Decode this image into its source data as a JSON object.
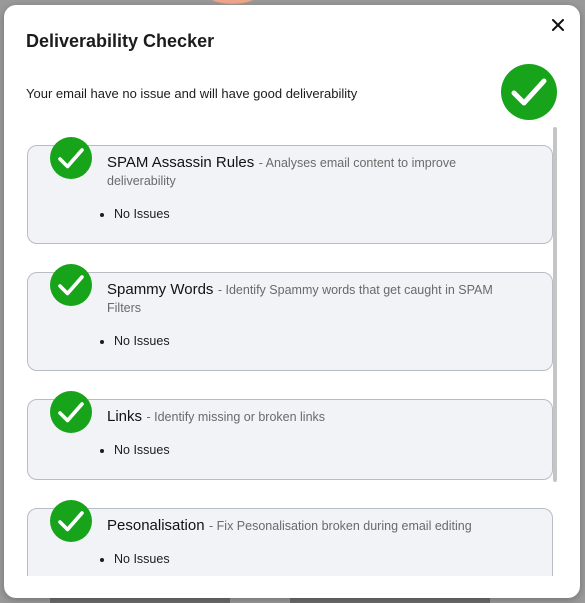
{
  "modal": {
    "title": "Deliverability Checker",
    "close_icon": "close-icon",
    "summary_text": "Your email have no issue and will have good deliverability",
    "summary_status_icon": "check-circle-icon",
    "status_color": "#17a31a"
  },
  "checks": [
    {
      "title": "SPAM Assassin Rules",
      "description": "- Analyses email content to improve deliverability",
      "status_icon": "check-circle-icon",
      "results": [
        "No Issues"
      ]
    },
    {
      "title": "Spammy Words",
      "description": "- Identify Spammy words that get caught in SPAM Filters",
      "status_icon": "check-circle-icon",
      "results": [
        "No Issues"
      ]
    },
    {
      "title": "Links",
      "description": "- Identify missing or broken links",
      "status_icon": "check-circle-icon",
      "results": [
        "No Issues"
      ]
    },
    {
      "title": "Pesonalisation",
      "description": "- Fix Pesonalisation broken during email editing",
      "status_icon": "check-circle-icon",
      "results": [
        "No Issues"
      ]
    }
  ]
}
